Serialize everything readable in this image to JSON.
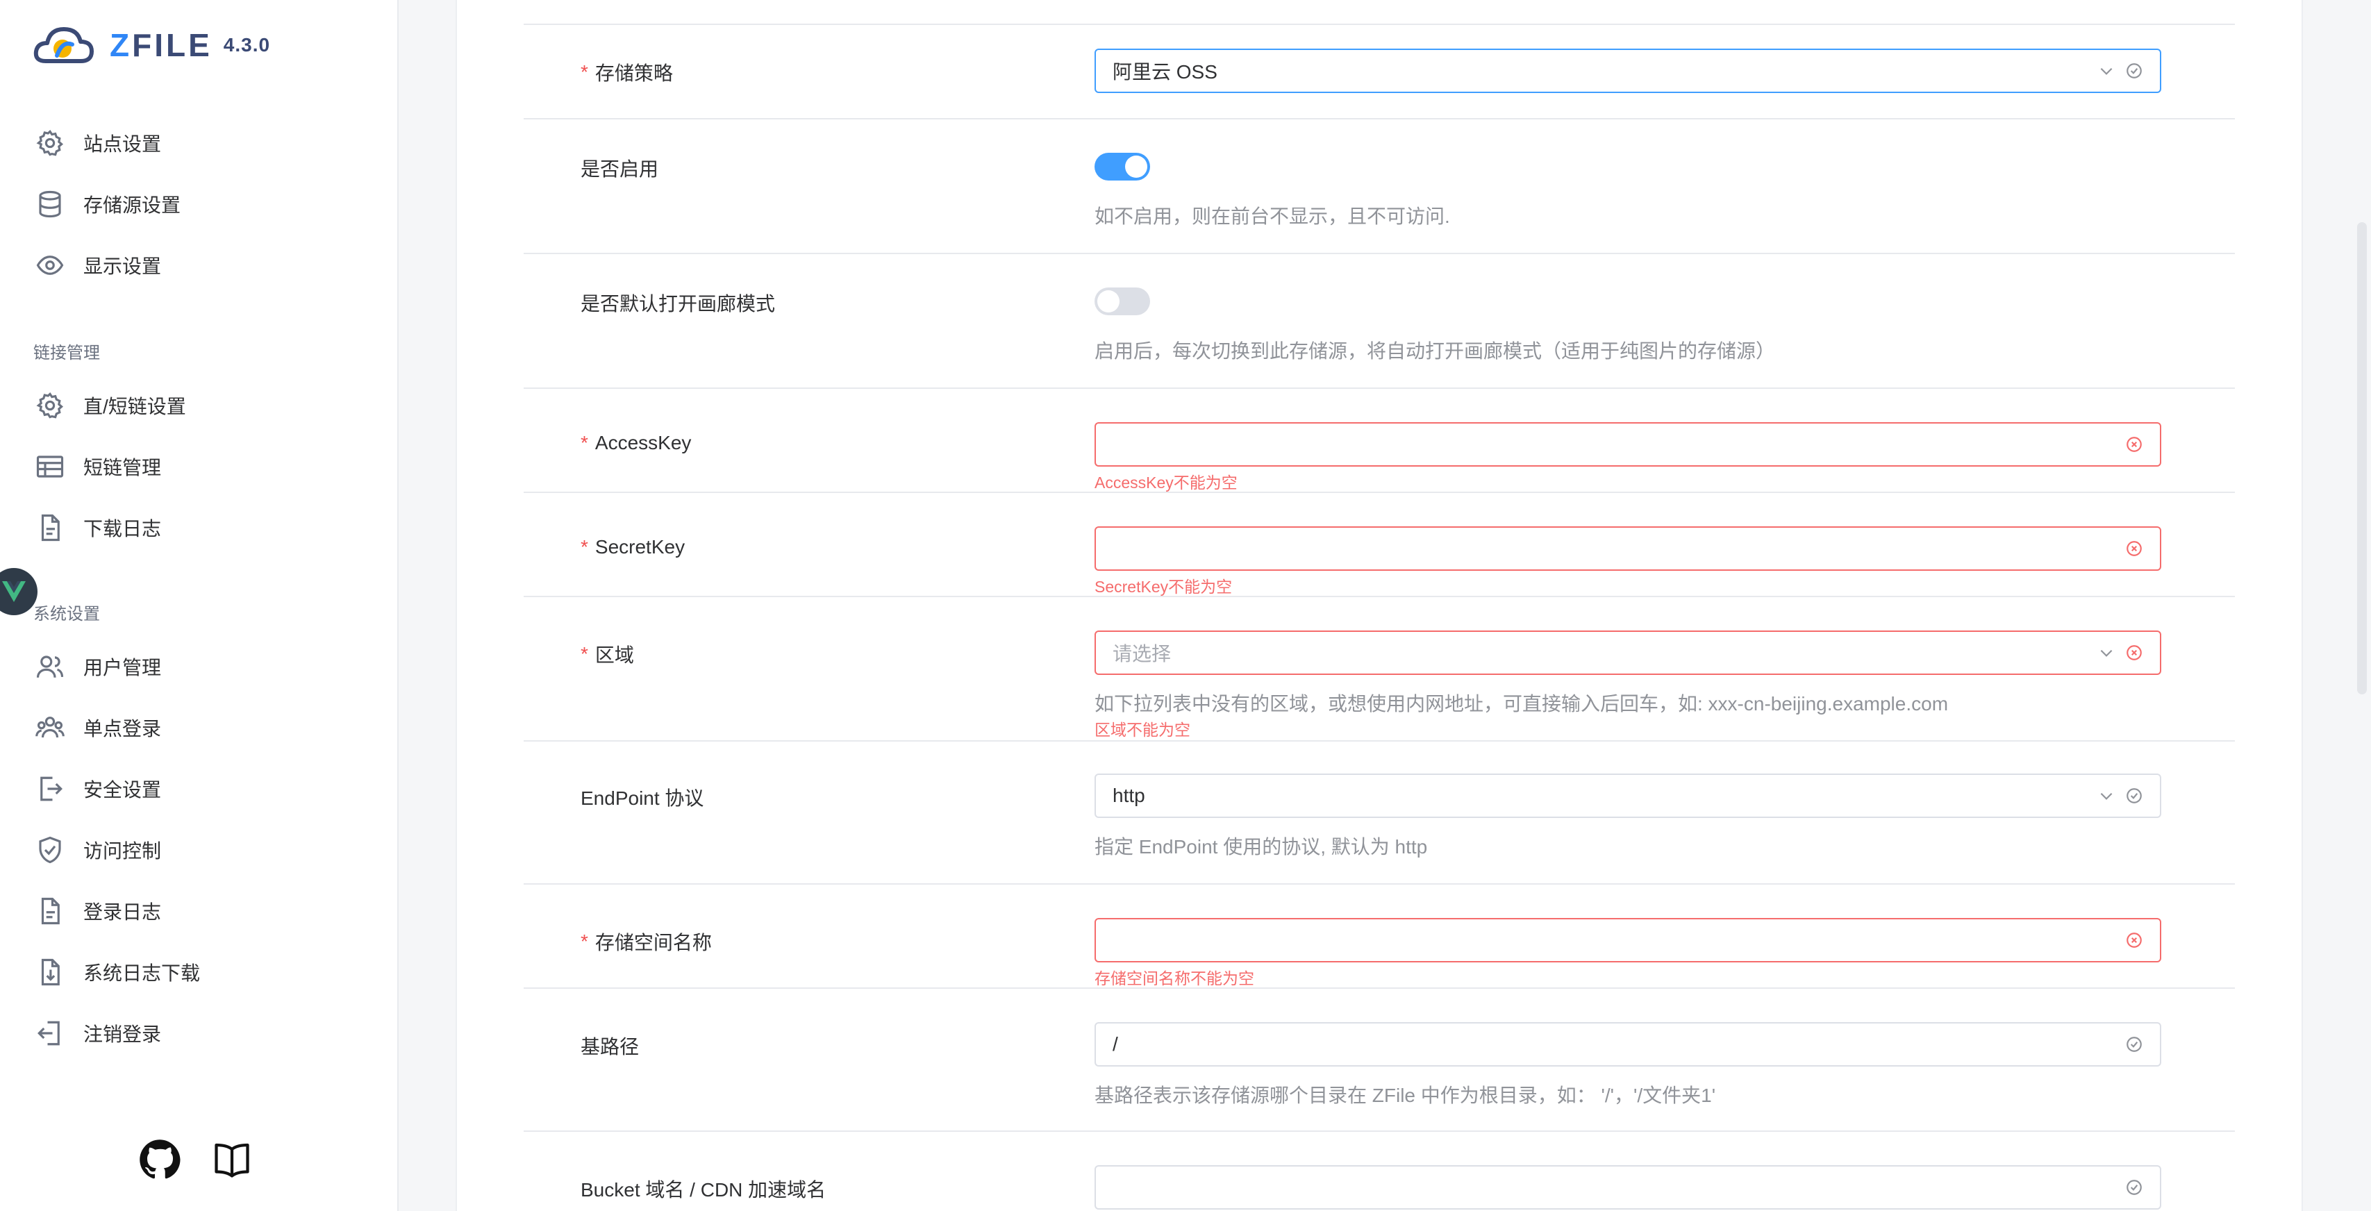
{
  "app": {
    "logo_text_z": "Z",
    "logo_text_rest": "FILE",
    "version": "4.3.0"
  },
  "sidebar": {
    "items": [
      {
        "label": "站点设置",
        "icon": "gear-icon"
      },
      {
        "label": "存储源设置",
        "icon": "database-icon"
      },
      {
        "label": "显示设置",
        "icon": "eye-icon"
      }
    ],
    "group_link": "链接管理",
    "link_items": [
      {
        "label": "直/短链设置",
        "icon": "gear-icon"
      },
      {
        "label": "短链管理",
        "icon": "table-icon"
      },
      {
        "label": "下载日志",
        "icon": "document-icon"
      }
    ],
    "group_system": "系统设置",
    "system_items": [
      {
        "label": "用户管理",
        "icon": "user-icon"
      },
      {
        "label": "单点登录",
        "icon": "users-icon"
      },
      {
        "label": "安全设置",
        "icon": "logout-icon"
      },
      {
        "label": "访问控制",
        "icon": "shield-check-icon"
      },
      {
        "label": "登录日志",
        "icon": "document-icon"
      },
      {
        "label": "系统日志下载",
        "icon": "download-document-icon"
      },
      {
        "label": "注销登录",
        "icon": "exit-icon"
      }
    ],
    "footer_icons": [
      "github-icon",
      "book-icon"
    ]
  },
  "form": {
    "storage_strategy": {
      "label": "存储策略",
      "value": "阿里云 OSS"
    },
    "enabled": {
      "label": "是否启用",
      "on": true,
      "help": "如不启用，则在前台不显示，且不可访问."
    },
    "gallery": {
      "label": "是否默认打开画廊模式",
      "on": false,
      "help": "启用后，每次切换到此存储源，将自动打开画廊模式（适用于纯图片的存储源）"
    },
    "access_key": {
      "label": "AccessKey",
      "value": "",
      "error": "AccessKey不能为空"
    },
    "secret_key": {
      "label": "SecretKey",
      "value": "",
      "error": "SecretKey不能为空"
    },
    "region": {
      "label": "区域",
      "placeholder": "请选择",
      "help": "如下拉列表中没有的区域，或想使用内网地址，可直接输入后回车，如: xxx-cn-beijing.example.com",
      "error": "区域不能为空"
    },
    "endpoint_protocol": {
      "label": "EndPoint 协议",
      "value": "http",
      "help": "指定 EndPoint 使用的协议, 默认为 http"
    },
    "bucket_name": {
      "label": "存储空间名称",
      "value": "",
      "error": "存储空间名称不能为空"
    },
    "base_path": {
      "label": "基路径",
      "value": "/",
      "help": "基路径表示该存储源哪个目录在 ZFile 中作为根目录，如： '/'，'/文件夹1'"
    },
    "bucket_domain": {
      "label": "Bucket 域名 / CDN 加速域名",
      "value": ""
    }
  },
  "colors": {
    "primary": "#409eff",
    "error": "#f56c6c",
    "required_mark": "#f05050"
  }
}
